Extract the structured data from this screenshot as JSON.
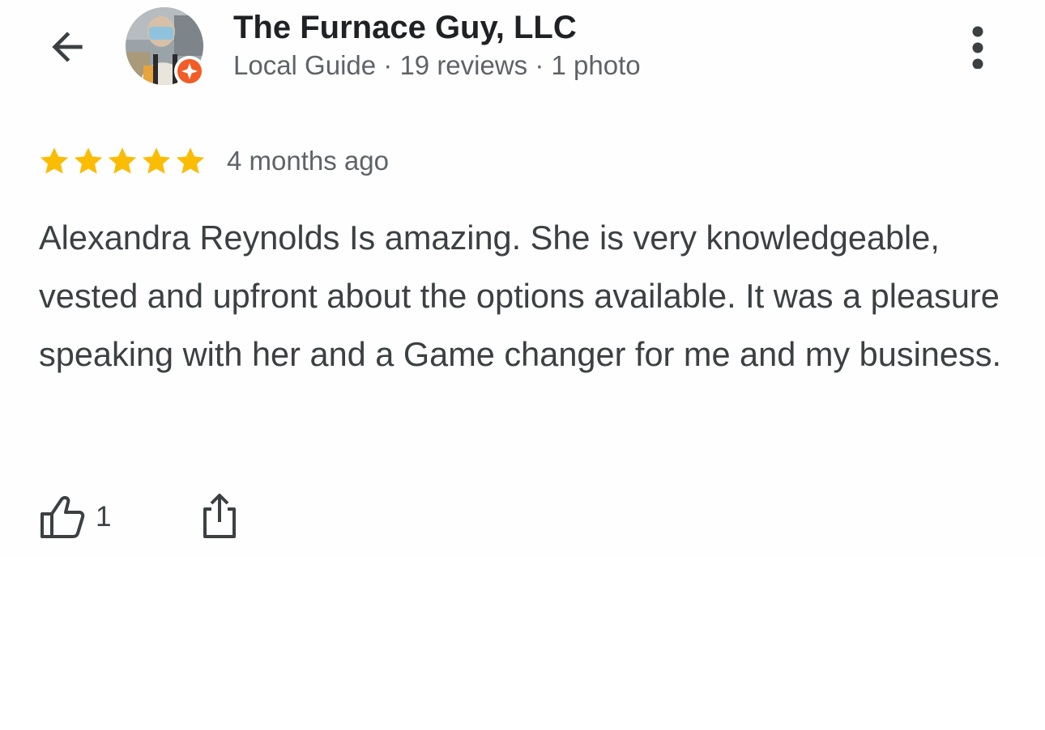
{
  "header": {
    "author_name": "The Furnace Guy, LLC",
    "author_meta": "Local Guide · 19 reviews · 1 photo",
    "back_icon": "arrow-left-icon",
    "more_icon": "more-vertical-icon",
    "badge_icon": "local-guide-badge-icon"
  },
  "review": {
    "rating": 5,
    "max_rating": 5,
    "time": "4 months ago",
    "text": "Alexandra Reynolds Is amazing. She is very knowledgeable, vested and upfront about the options available. It was a pleasure speaking with her and a Game changer for me and my business."
  },
  "actions": {
    "like_count": "1",
    "like_icon": "thumbs-up-icon",
    "share_icon": "share-icon"
  },
  "colors": {
    "star": "#FBBC04",
    "badge": "#F25C26",
    "icon": "#3c4043"
  }
}
